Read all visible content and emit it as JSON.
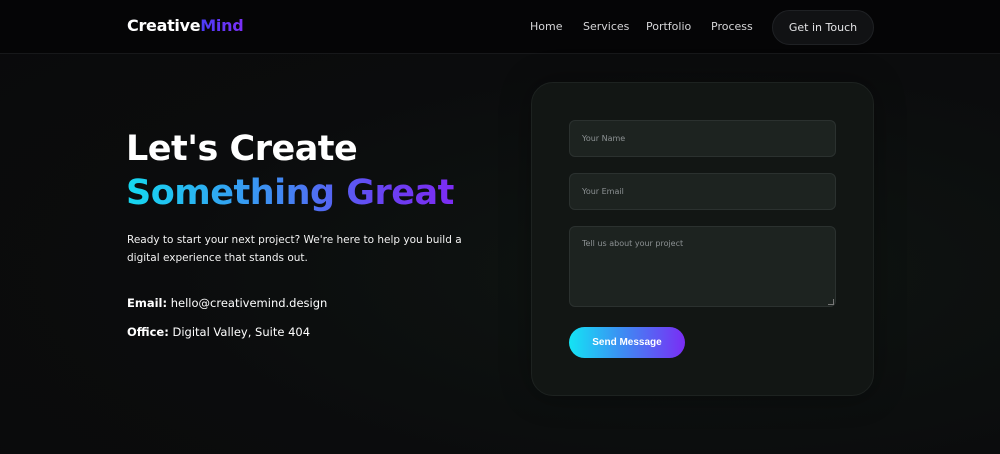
{
  "header": {
    "logo": {
      "part_a": "Creative",
      "part_b": "Mind"
    },
    "nav": [
      {
        "label": "Home"
      },
      {
        "label": "Services"
      },
      {
        "label": "Portfolio"
      },
      {
        "label": "Process"
      }
    ],
    "cta_label": "Get in Touch"
  },
  "hero": {
    "title_line_1": "Let's Create",
    "title_line_2": "Something Great",
    "description": "Ready to start your next project? We're here to help you build a digital experience that stands out.",
    "contact": [
      {
        "label": "Email:",
        "value": "hello@creativemind.design"
      },
      {
        "label": "Office:",
        "value": "Digital Valley, Suite 404"
      }
    ]
  },
  "form": {
    "name_placeholder": "Your Name",
    "email_placeholder": "Your Email",
    "message_placeholder": "Tell us about your project",
    "submit_label": "Send Message"
  },
  "colors": {
    "background": "#0b0b0d",
    "accent_start": "#15d9f0",
    "accent_end": "#7c2cf3"
  }
}
